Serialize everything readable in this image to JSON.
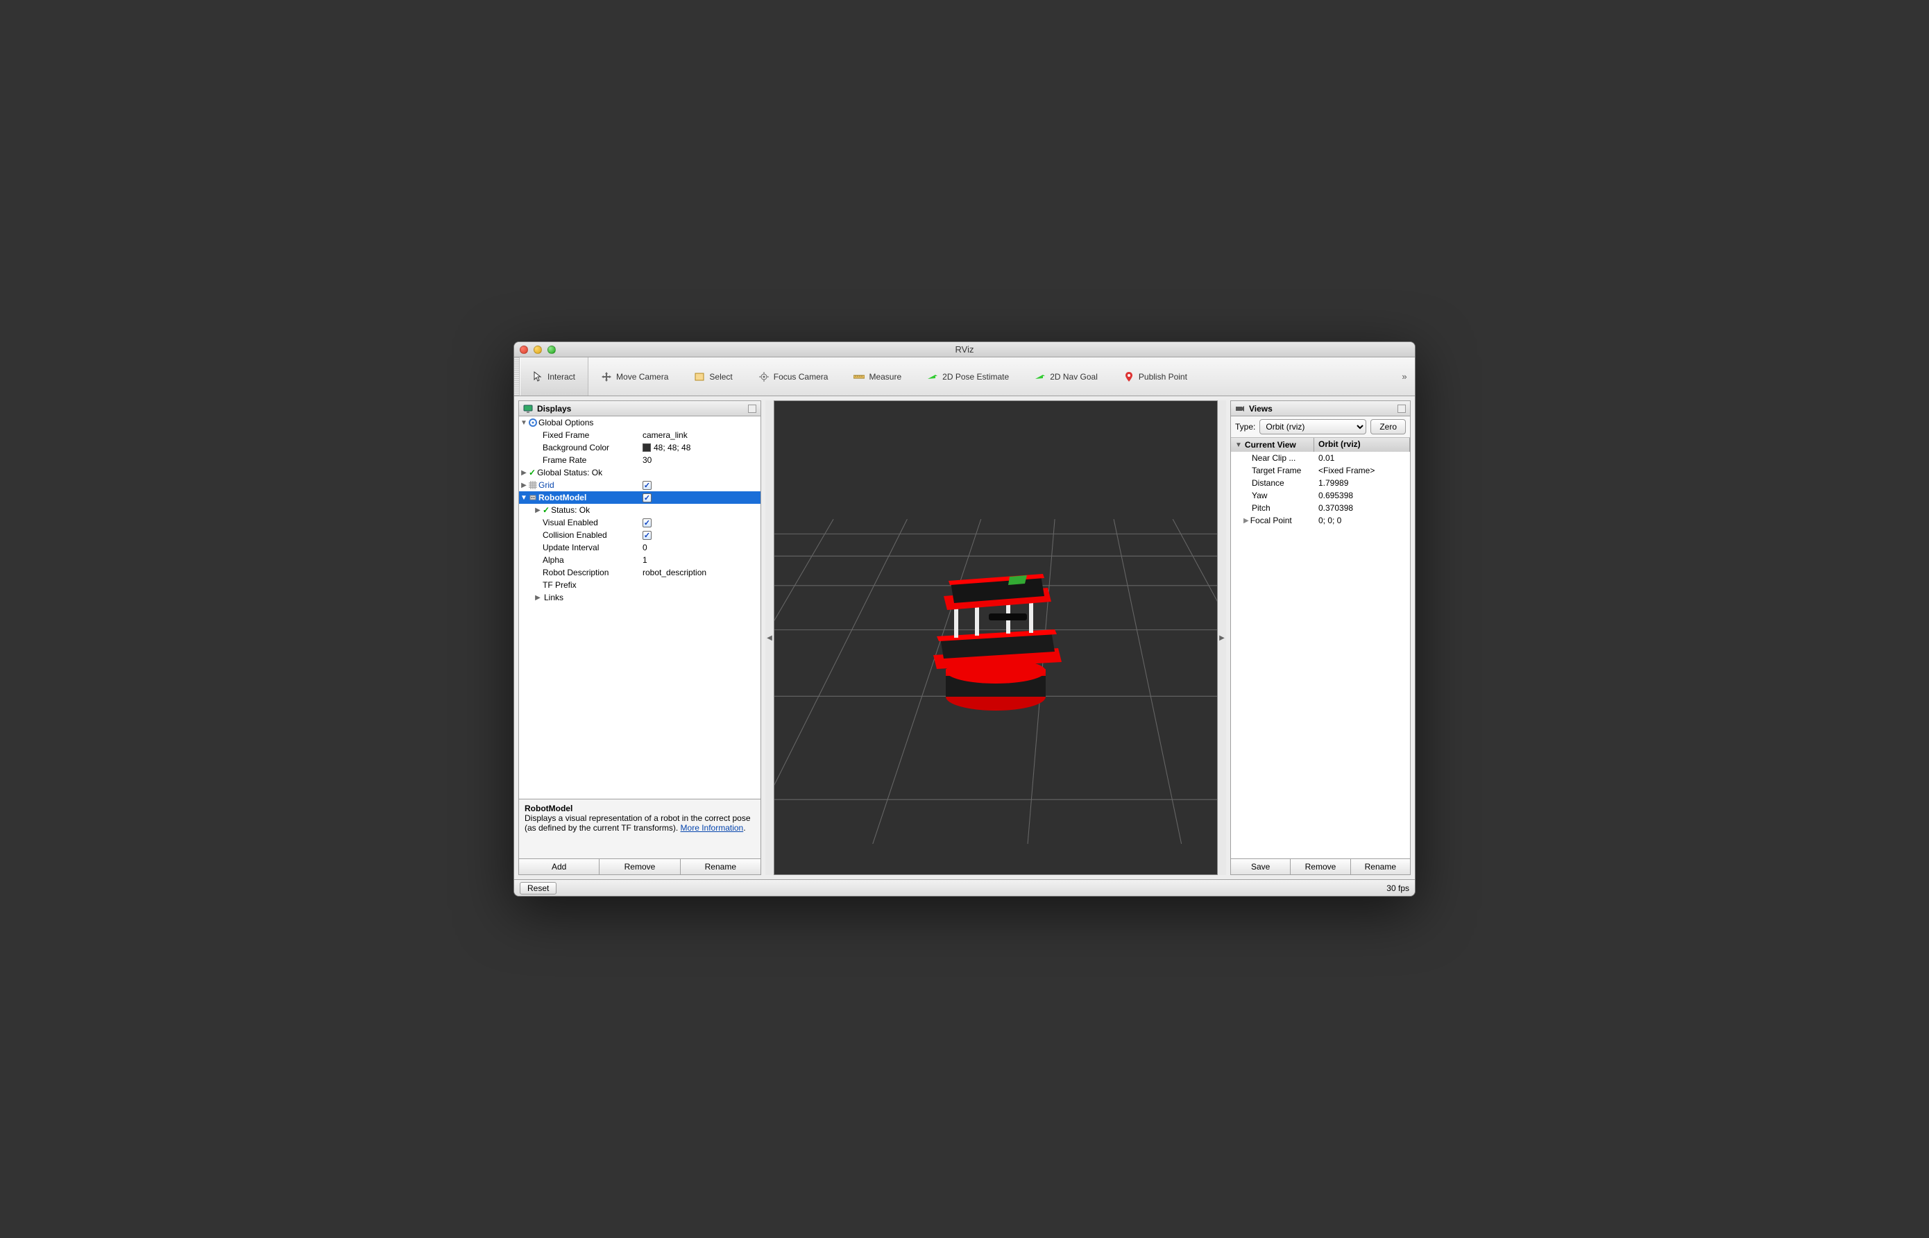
{
  "window": {
    "title": "RViz"
  },
  "toolbar": {
    "items": [
      {
        "label": "Interact",
        "icon": "cursor"
      },
      {
        "label": "Move Camera",
        "icon": "move"
      },
      {
        "label": "Select",
        "icon": "select"
      },
      {
        "label": "Focus Camera",
        "icon": "focus"
      },
      {
        "label": "Measure",
        "icon": "measure"
      },
      {
        "label": "2D Pose Estimate",
        "icon": "arrow-green"
      },
      {
        "label": "2D Nav Goal",
        "icon": "arrow-green"
      },
      {
        "label": "Publish Point",
        "icon": "pin"
      }
    ],
    "overflow": "»"
  },
  "displays": {
    "panel_title": "Displays",
    "global_options": {
      "label": "Global Options",
      "fixed_frame": {
        "k": "Fixed Frame",
        "v": "camera_link"
      },
      "background_color": {
        "k": "Background Color",
        "v": "48; 48; 48"
      },
      "frame_rate": {
        "k": "Frame Rate",
        "v": "30"
      }
    },
    "global_status": {
      "label": "Global Status: Ok"
    },
    "grid": {
      "label": "Grid",
      "checked": true
    },
    "robot_model": {
      "label": "RobotModel",
      "checked": true,
      "status": {
        "label": "Status: Ok"
      },
      "visual_enabled": {
        "k": "Visual Enabled",
        "checked": true
      },
      "collision_enabled": {
        "k": "Collision Enabled",
        "checked": true
      },
      "update_interval": {
        "k": "Update Interval",
        "v": "0"
      },
      "alpha": {
        "k": "Alpha",
        "v": "1"
      },
      "robot_description": {
        "k": "Robot Description",
        "v": "robot_description"
      },
      "tf_prefix": {
        "k": "TF Prefix",
        "v": ""
      },
      "links": {
        "label": "Links"
      }
    },
    "desc": {
      "title": "RobotModel",
      "text": "Displays a visual representation of a robot in the correct pose (as defined by the current TF transforms). ",
      "more": "More Information"
    },
    "buttons": {
      "add": "Add",
      "remove": "Remove",
      "rename": "Rename"
    }
  },
  "views": {
    "panel_title": "Views",
    "type_label": "Type:",
    "type_value": "Orbit (rviz)",
    "zero": "Zero",
    "header": {
      "c1": "Current View",
      "c2": "Orbit (rviz)"
    },
    "rows": {
      "near_clip": {
        "k": "Near Clip ...",
        "v": "0.01"
      },
      "target_frame": {
        "k": "Target Frame",
        "v": "<Fixed Frame>"
      },
      "distance": {
        "k": "Distance",
        "v": "1.79989"
      },
      "yaw": {
        "k": "Yaw",
        "v": "0.695398"
      },
      "pitch": {
        "k": "Pitch",
        "v": "0.370398"
      },
      "focal_point": {
        "k": "Focal Point",
        "v": "0; 0; 0"
      }
    },
    "buttons": {
      "save": "Save",
      "remove": "Remove",
      "rename": "Rename"
    }
  },
  "statusbar": {
    "reset": "Reset",
    "fps": "30 fps"
  }
}
